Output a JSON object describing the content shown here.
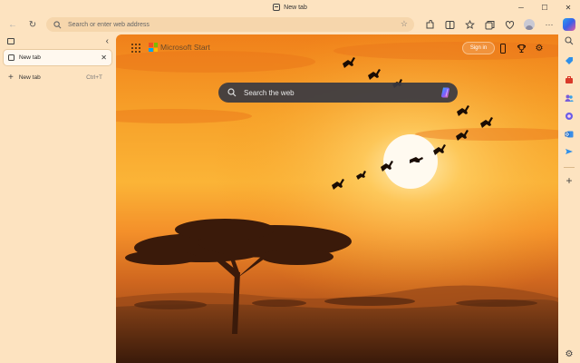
{
  "window": {
    "title": "New tab",
    "minimize_glyph": "─",
    "maximize_glyph": "☐",
    "close_glyph": "✕"
  },
  "toolbar": {
    "back_glyph": "←",
    "refresh_glyph": "↻",
    "address_placeholder": "Search or enter web address",
    "favorite_glyph": "☆",
    "more_glyph": "···",
    "icons": [
      "extensions-icon",
      "split-screen-icon",
      "favorites-icon",
      "collections-icon",
      "browser-essentials-icon",
      "profile-avatar",
      "more-icon"
    ]
  },
  "tabs_panel": {
    "collapse_glyph": "‹",
    "tabs": [
      {
        "label": "New tab",
        "close_glyph": "✕",
        "active": true
      }
    ],
    "new_tab_label": "New tab",
    "new_tab_shortcut": "Ctrl+T",
    "new_tab_glyph": "+"
  },
  "new_tab_page": {
    "brand": "Microsoft Start",
    "signin_label": "Sign in",
    "search_placeholder": "Search the web",
    "trophy_glyph": "🏆",
    "settings_glyph": "⚙",
    "background": "African savanna sunset with acacia tree and flying birds"
  },
  "right_sidebar": {
    "add_glyph": "+",
    "settings_glyph": "⚙",
    "items": [
      "search-icon",
      "tag-icon",
      "toolbox-icon",
      "people-icon",
      "office-icon",
      "outlook-icon",
      "send-icon"
    ]
  },
  "colors": {
    "chrome": "#fde3c0",
    "address_bar": "#f6d6ac",
    "searchbox": "#3a3a42",
    "sky_top": "#f59a1c",
    "sun": "#ffffff"
  }
}
